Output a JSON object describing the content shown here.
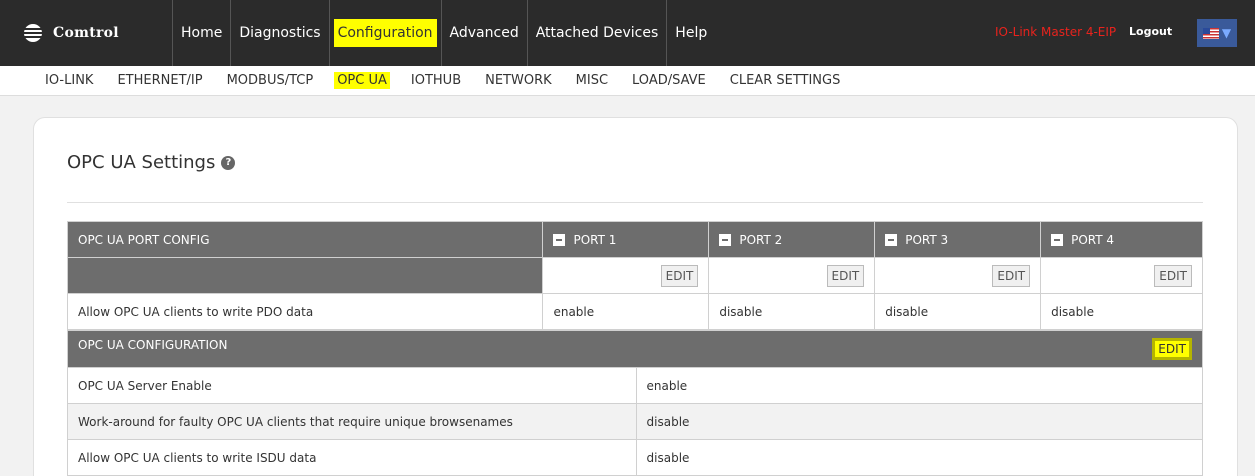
{
  "brand": {
    "name": "Comtrol"
  },
  "nav": {
    "items": [
      "Home",
      "Diagnostics",
      "Configuration",
      "Advanced",
      "Attached Devices",
      "Help"
    ],
    "active": "Configuration",
    "device_name": "IO-Link Master 4-EIP",
    "logout": "Logout",
    "language_icon": "us-flag-icon"
  },
  "subnav": {
    "items": [
      "IO-LINK",
      "ETHERNET/IP",
      "MODBUS/TCP",
      "OPC UA",
      "IOTHUB",
      "NETWORK",
      "MISC",
      "LOAD/SAVE",
      "CLEAR SETTINGS"
    ],
    "active": "OPC UA"
  },
  "page": {
    "title": "OPC UA Settings"
  },
  "port_config": {
    "header": "OPC UA PORT CONFIG",
    "ports": [
      "PORT 1",
      "PORT 2",
      "PORT 3",
      "PORT 4"
    ],
    "edit_label": "EDIT",
    "rows": [
      {
        "label": "Allow OPC UA clients to write PDO data",
        "values": [
          "enable",
          "disable",
          "disable",
          "disable"
        ]
      }
    ]
  },
  "ua_config": {
    "header": "OPC UA CONFIGURATION",
    "edit_label": "EDIT",
    "rows": [
      {
        "label": "OPC UA Server Enable",
        "value": "enable"
      },
      {
        "label": "Work-around for faulty OPC UA clients that require unique browsenames",
        "value": "disable"
      },
      {
        "label": "Allow OPC UA clients to write ISDU data",
        "value": "disable"
      }
    ]
  },
  "colors": {
    "topbar": "#2b2b2b",
    "highlight": "#ffff00",
    "header_gray": "#6d6d6d",
    "device_red": "#e8231d"
  }
}
